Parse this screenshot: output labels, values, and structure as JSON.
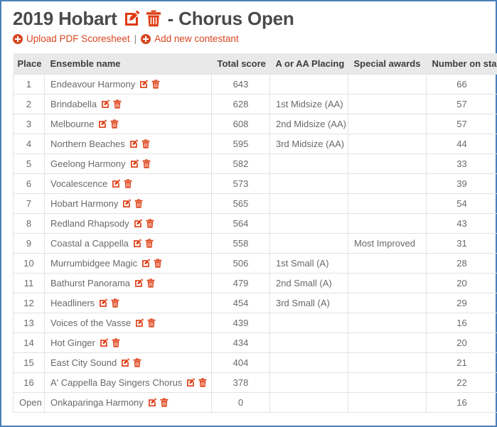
{
  "header": {
    "title_prefix": "2019 Hobart",
    "title_suffix": "- Chorus Open",
    "edit_icon": "edit-icon",
    "delete_icon": "trash-icon"
  },
  "actions": {
    "upload_label": "Upload PDF Scoresheet",
    "add_label": "Add new contestant",
    "separator": "|",
    "plus_icon": "plus-circle-icon"
  },
  "colors": {
    "accent": "#dd3b11",
    "link": "#d9461f",
    "title_text": "#4a4a4a",
    "header_bg": "#e9e9e9",
    "cell_text": "#696969",
    "border": "#e2e2e2",
    "page_border": "#4a7ebb"
  },
  "table": {
    "columns": [
      "Place",
      "Ensemble name",
      "Total score",
      "A or AA Placing",
      "Special awards",
      "Number on stage"
    ],
    "rows": [
      {
        "place": "1",
        "name": "Endeavour Harmony",
        "score": "643",
        "placing": "",
        "special": "",
        "stage": "66"
      },
      {
        "place": "2",
        "name": "Brindabella",
        "score": "628",
        "placing": "1st Midsize (AA)",
        "special": "",
        "stage": "57"
      },
      {
        "place": "3",
        "name": "Melbourne",
        "score": "608",
        "placing": "2nd Midsize (AA)",
        "special": "",
        "stage": "57"
      },
      {
        "place": "4",
        "name": "Northern Beaches",
        "score": "595",
        "placing": "3rd Midsize (AA)",
        "special": "",
        "stage": "44"
      },
      {
        "place": "5",
        "name": "Geelong Harmony",
        "score": "582",
        "placing": "",
        "special": "",
        "stage": "33"
      },
      {
        "place": "6",
        "name": "Vocalescence",
        "score": "573",
        "placing": "",
        "special": "",
        "stage": "39"
      },
      {
        "place": "7",
        "name": "Hobart Harmony",
        "score": "565",
        "placing": "",
        "special": "",
        "stage": "54"
      },
      {
        "place": "8",
        "name": "Redland Rhapsody",
        "score": "564",
        "placing": "",
        "special": "",
        "stage": "43"
      },
      {
        "place": "9",
        "name": "Coastal a Cappella",
        "score": "558",
        "placing": "",
        "special": "Most Improved",
        "stage": "31"
      },
      {
        "place": "10",
        "name": "Murrumbidgee Magic",
        "score": "506",
        "placing": "1st Small (A)",
        "special": "",
        "stage": "28"
      },
      {
        "place": "11",
        "name": "Bathurst Panorama",
        "score": "479",
        "placing": "2nd Small (A)",
        "special": "",
        "stage": "20"
      },
      {
        "place": "12",
        "name": "Headliners",
        "score": "454",
        "placing": "3rd Small (A)",
        "special": "",
        "stage": "29"
      },
      {
        "place": "13",
        "name": "Voices of the Vasse",
        "score": "439",
        "placing": "",
        "special": "",
        "stage": "16"
      },
      {
        "place": "14",
        "name": "Hot Ginger",
        "score": "434",
        "placing": "",
        "special": "",
        "stage": "20"
      },
      {
        "place": "15",
        "name": "East City Sound",
        "score": "404",
        "placing": "",
        "special": "",
        "stage": "21"
      },
      {
        "place": "16",
        "name": "A' Cappella Bay Singers Chorus",
        "score": "378",
        "placing": "",
        "special": "",
        "stage": "22"
      },
      {
        "place": "Open",
        "name": "Onkaparinga Harmony",
        "score": "0",
        "placing": "",
        "special": "",
        "stage": "16"
      }
    ]
  }
}
